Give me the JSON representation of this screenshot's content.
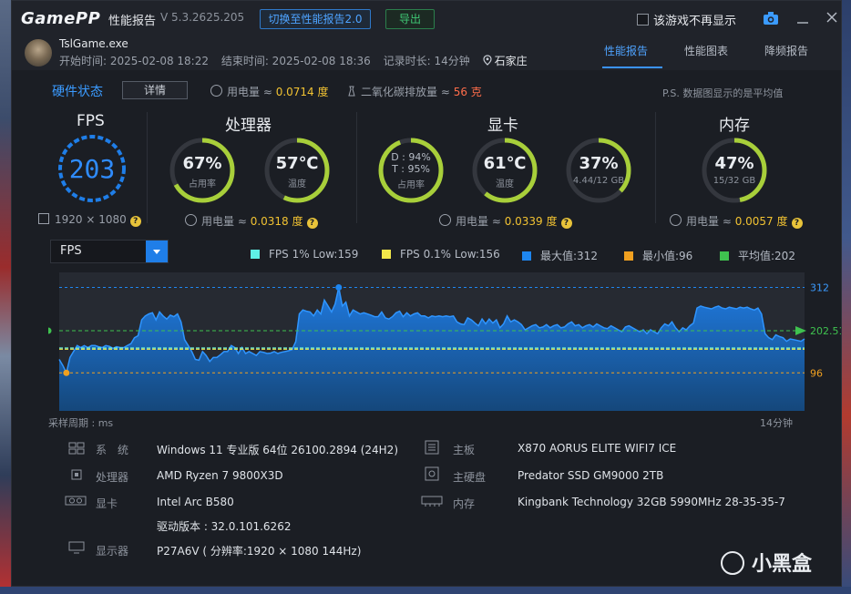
{
  "titlebar": {
    "logo": "GamePP",
    "title": "性能报告",
    "version": "V 5.3.2625.205",
    "switch_button": "切换至性能报告2.0",
    "export_button": "导出",
    "no_show_label": "该游戏不再显示"
  },
  "game": {
    "exe": "TslGame.exe",
    "start": "开始时间: 2025-02-08 18:22",
    "end": "结束时间: 2025-02-08 18:36",
    "duration": "记录时长: 14分钟",
    "city": "石家庄"
  },
  "tabs": [
    {
      "label": "性能报告",
      "active": true
    },
    {
      "label": "性能图表",
      "active": false
    },
    {
      "label": "降频报告",
      "active": false
    }
  ],
  "summary": {
    "hw_title": "硬件状态",
    "detail_button": "详情",
    "power_label": "用电量 ≈ ",
    "power_value": "0.0714 度",
    "co2_label": "二氧化碳排放量 ≈ ",
    "co2_value": "56 克",
    "note": "P.S. 数据图显示的是平均值"
  },
  "fps": {
    "title": "FPS",
    "value": "203",
    "resolution": "1920 × 1080"
  },
  "cpu": {
    "title": "处理器",
    "usage": "67%",
    "usage_label": "占用率",
    "usage_fraction": 0.67,
    "temp": "57℃",
    "temp_label": "温度",
    "temp_fraction": 0.57,
    "power_label": "用电量 ≈ ",
    "power_value": "0.0318 度"
  },
  "gpu": {
    "title": "显卡",
    "d_usage": "D : 94%",
    "t_usage": "T : 95%",
    "usage_label": "占用率",
    "usage_fraction": 0.94,
    "temp": "61℃",
    "temp_label": "温度",
    "temp_fraction": 0.61,
    "vram": "37%",
    "vram_sub": "4.44/12 GB",
    "vram_fraction": 0.37,
    "power_label": "用电量 ≈ ",
    "power_value": "0.0339 度"
  },
  "memory": {
    "title": "内存",
    "usage": "47%",
    "usage_sub": "15/32 GB",
    "usage_fraction": 0.47,
    "power_label": "用电量 ≈ ",
    "power_value": "0.0057 度"
  },
  "chart_controls": {
    "metric": "FPS"
  },
  "colors": {
    "accent": "#3b93ff",
    "gauge_green": "#a8cf3a",
    "gauge_track": "#34373e",
    "fps_low1": "#5ff0e6",
    "fps_low01": "#f2e84a",
    "max": "#1e86f0",
    "min": "#f0a020",
    "avg": "#3fc24f"
  },
  "chart_data": {
    "type": "area",
    "legend": [
      {
        "name": "FPS 1% Low:159",
        "color": "#5ff0e6"
      },
      {
        "name": "FPS 0.1% Low:156",
        "color": "#f2e84a"
      },
      {
        "name": "最大值:312",
        "color": "#1e86f0"
      },
      {
        "name": "最小值:96",
        "color": "#f0a020"
      },
      {
        "name": "平均值:202",
        "color": "#3fc24f"
      }
    ],
    "reference_lines": {
      "max": 312,
      "avg": 202.51,
      "min": 96,
      "low1": 159,
      "low01": 156
    },
    "ref_labels": {
      "max": "312",
      "avg": "202.51",
      "min": "96"
    },
    "ylim": [
      0,
      350
    ],
    "xlabel_left": "采样周期 : ms",
    "xlabel_right": "14分钟",
    "series": [
      {
        "values": [
          130,
          115,
          96,
          135,
          150,
          165,
          160,
          165,
          160,
          165,
          165,
          162,
          160,
          165,
          163,
          158,
          162,
          160,
          160,
          165,
          170,
          185,
          190,
          230,
          240,
          245,
          248,
          230,
          250,
          240,
          232,
          242,
          238,
          245,
          225,
          180,
          165,
          150,
          130,
          128,
          150,
          140,
          125,
          135,
          135,
          142,
          150,
          150,
          165,
          160,
          145,
          160,
          145,
          150,
          145,
          140,
          150,
          148,
          145,
          146,
          150,
          145,
          148,
          150,
          152,
          155,
          175,
          245,
          255,
          252,
          250,
          240,
          255,
          245,
          280,
          265,
          250,
          270,
          312,
          265,
          275,
          240,
          255,
          250,
          245,
          248,
          245,
          242,
          238,
          238,
          250,
          235,
          232,
          238,
          248,
          252,
          238,
          248,
          240,
          245,
          248,
          240,
          240,
          235,
          240,
          238,
          240,
          238,
          240,
          238,
          240,
          225,
          220,
          218,
          235,
          230,
          222,
          215,
          232,
          220,
          232,
          222,
          230,
          210,
          220,
          240,
          225,
          230,
          225,
          218,
          205,
          210,
          215,
          218,
          210,
          212,
          218,
          210,
          215,
          218,
          210,
          212,
          220,
          225,
          215,
          218,
          210,
          215,
          218,
          212,
          220,
          215,
          210,
          208,
          215,
          210,
          205,
          200,
          212,
          215,
          210,
          205,
          200,
          205,
          195,
          205,
          200,
          195,
          210,
          220,
          215,
          225,
          210,
          200,
          210,
          205,
          215,
          222,
          260,
          265,
          262,
          260,
          258,
          262,
          265,
          260,
          258,
          262,
          260,
          258,
          262,
          260,
          262,
          258,
          255,
          260,
          245,
          195,
          185,
          180,
          192,
          188,
          185,
          176,
          182,
          180,
          178,
          176,
          182
        ]
      }
    ]
  },
  "specs": {
    "os_label": "系　统",
    "os": "Windows 11 专业版 64位 26100.2894 (24H2)",
    "cpu_label": "处理器",
    "cpu": "AMD Ryzen 7 9800X3D",
    "gpu_label": "显卡",
    "gpu": "Intel Arc B580",
    "driver": "驱动版本 : 32.0.101.6262",
    "monitor_label": "显示器",
    "monitor": "P27A6V ( 分辨率:1920 × 1080 144Hz)",
    "board_label": "主板",
    "board": "X870 AORUS ELITE WIFI7 ICE",
    "disk_label": "主硬盘",
    "disk": "Predator SSD GM9000 2TB",
    "mem_label": "内存",
    "mem": "Kingbank Technology 32GB 5990MHz 28-35-35-7"
  },
  "watermark": "小黑盒"
}
